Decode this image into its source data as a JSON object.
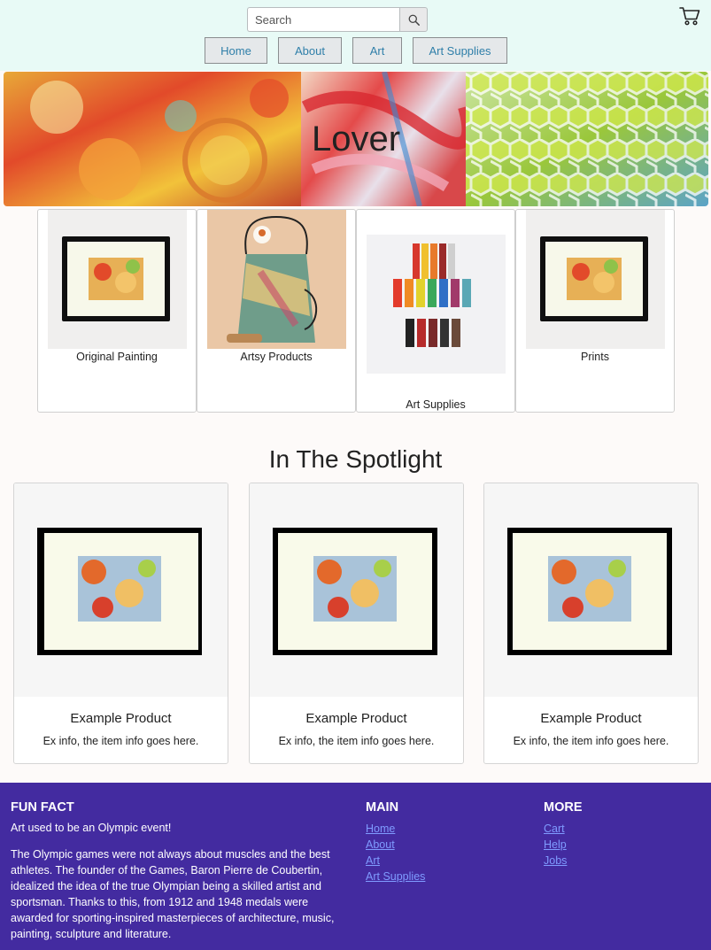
{
  "colors": {
    "header_bg": "#e8faf6",
    "nav_text": "#2f7fa9",
    "footer_bg": "#432ba0",
    "footer_link": "#7f9bff"
  },
  "header": {
    "search": {
      "placeholder": "Search",
      "value": "",
      "icon": "search-icon"
    },
    "cart_icon": "cart-icon",
    "nav": [
      {
        "label": "Home"
      },
      {
        "label": "About"
      },
      {
        "label": "Art"
      },
      {
        "label": "Art Supplies"
      }
    ]
  },
  "hero": {
    "title": "Lover"
  },
  "categories": [
    {
      "label": "Original Painting"
    },
    {
      "label": "Artsy Products"
    },
    {
      "label": "Art Supplies"
    },
    {
      "label": "Prints"
    }
  ],
  "spotlight": {
    "title": "In The Spotlight",
    "products": [
      {
        "name": "Example Product",
        "info": "Ex info, the item info goes here."
      },
      {
        "name": "Example Product",
        "info": "Ex info, the item info goes here."
      },
      {
        "name": "Example Product",
        "info": "Ex info, the item info goes here."
      }
    ]
  },
  "footer": {
    "fun_fact": {
      "heading": "FUN FACT",
      "subheading": "Art used to be an Olympic event!",
      "paragraph": "The Olympic games were not always about muscles and the best athletes. The founder of the Games, Baron Pierre de Coubertin, idealized the idea of the true Olympian being a skilled artist and sportsman. Thanks to this, from 1912 and 1948 medals were awarded for sporting-inspired masterpieces of architecture, music, painting, sculpture and literature."
    },
    "main": {
      "heading": "MAIN",
      "links": [
        "Home",
        "About",
        "Art",
        "Art Supplies"
      ]
    },
    "more": {
      "heading": "MORE",
      "links": [
        "Cart",
        "Help",
        "Jobs"
      ]
    }
  }
}
